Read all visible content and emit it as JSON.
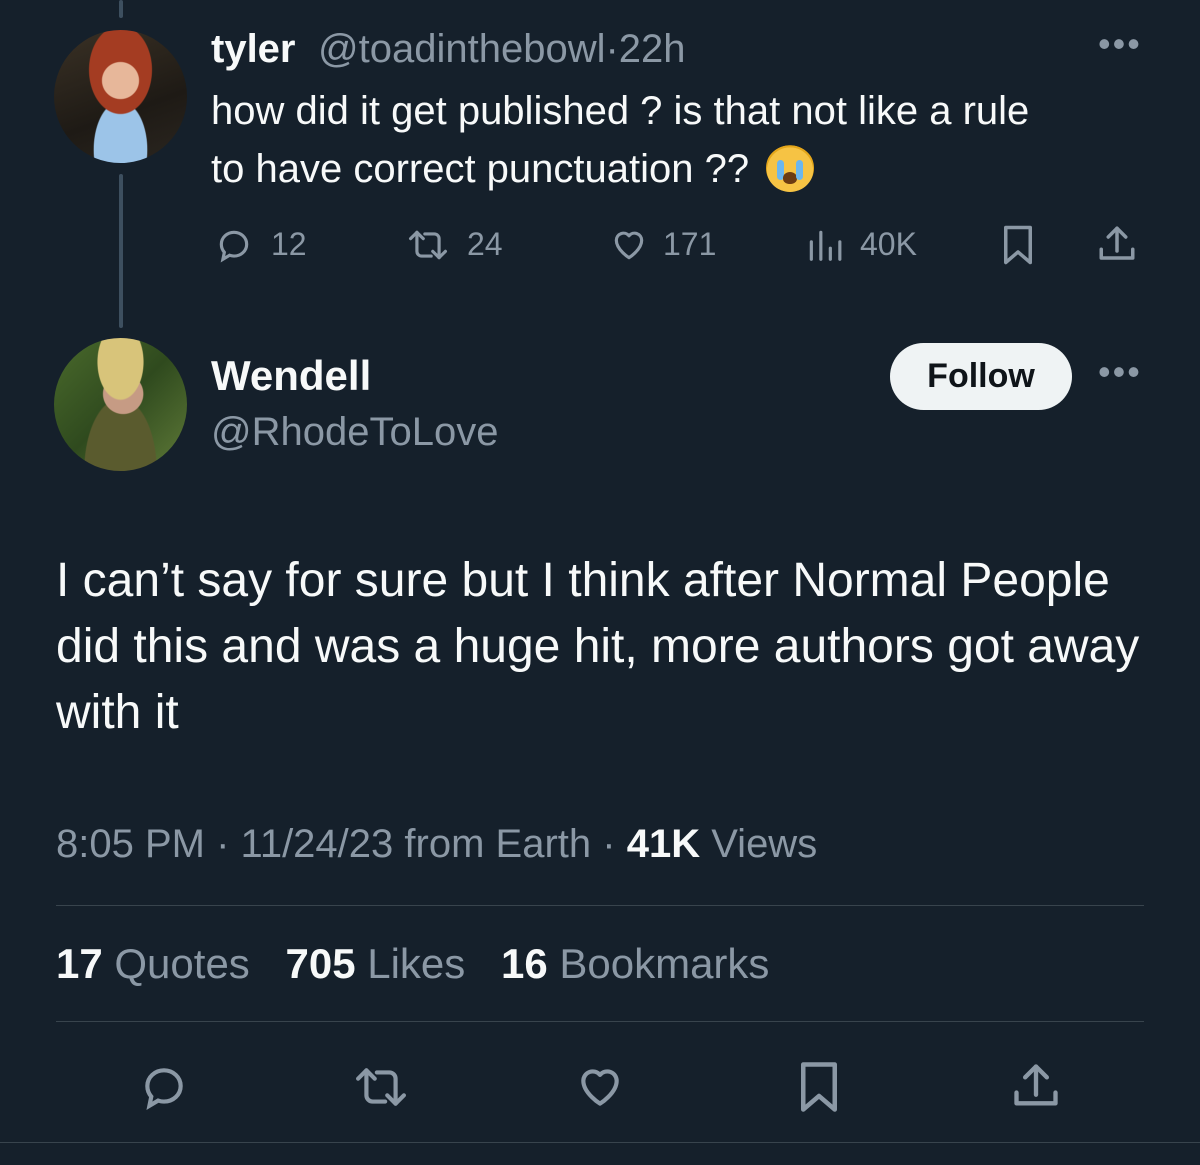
{
  "parent_tweet": {
    "name": "tyler",
    "handle": "@toadinthebowl",
    "separator": "·",
    "time": "22h",
    "text": "how did it get published ? is that not like a rule to have correct punctuation ??",
    "emoji": "loudly-crying-face",
    "replies": "12",
    "retweets": "24",
    "likes": "171",
    "views": "40K"
  },
  "main_tweet": {
    "name": "Wendell",
    "handle": "@RhodeToLove",
    "follow_label": "Follow",
    "text": "I can’t say for sure but I think after Normal People did this and was a huge hit, more authors got away with it",
    "time": "8:05 PM",
    "date": "11/24/23",
    "location": "from Earth",
    "views_count": "41K",
    "views_label": "Views",
    "separator": "·",
    "quotes_count": "17",
    "quotes_label": "Quotes",
    "likes_count": "705",
    "likes_label": "Likes",
    "bookmarks_count": "16",
    "bookmarks_label": "Bookmarks"
  },
  "colors": {
    "background": "#15202b",
    "primary_text": "#f7f9f9",
    "secondary_text": "#8b98a5",
    "divider": "#38444d",
    "follow_button_bg": "#eff3f4"
  },
  "icons": {
    "more": "more-icon",
    "reply": "reply-icon",
    "retweet": "retweet-icon",
    "like": "heart-icon",
    "views": "views-icon",
    "bookmark": "bookmark-icon",
    "share": "share-icon"
  }
}
